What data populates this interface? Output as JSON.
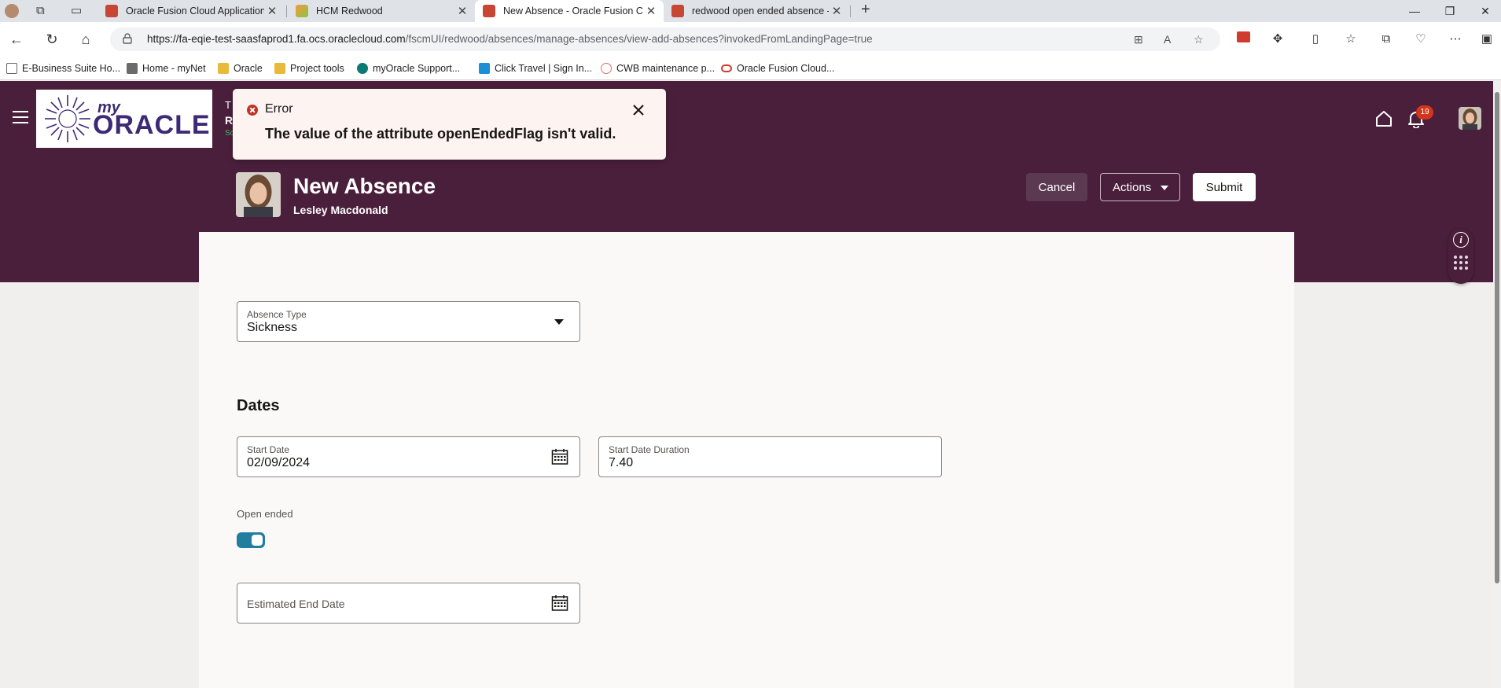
{
  "browser": {
    "tabs": [
      {
        "title": "Oracle Fusion Cloud Applications"
      },
      {
        "title": "HCM Redwood"
      },
      {
        "title": "New Absence - Oracle Fusion Clo"
      },
      {
        "title": "redwood open ended absence - C"
      }
    ],
    "address": {
      "host": "https://fa-eqie-test-saasfaprod1.fa.ocs.oraclecloud.com",
      "path": "/fscmUI/redwood/absences/manage-absences/view-add-absences?invokedFromLandingPage=true"
    },
    "bookmarks": [
      {
        "label": "E-Business Suite Ho...",
        "icon": "page-icon"
      },
      {
        "label": "Home - myNet",
        "icon": "mynet-icon"
      },
      {
        "label": "Oracle",
        "icon": "folder-icon"
      },
      {
        "label": "Project tools",
        "icon": "folder-icon"
      },
      {
        "label": "myOracle Support...",
        "icon": "sharepoint-icon"
      },
      {
        "label": "Click Travel | Sign In...",
        "icon": "travel-icon"
      },
      {
        "label": "CWB maintenance p...",
        "icon": "cwb-icon"
      },
      {
        "label": "Oracle Fusion Cloud...",
        "icon": "oracle-icon"
      }
    ]
  },
  "app": {
    "logo": {
      "my": "my",
      "oracle": "ORACLE"
    },
    "peek": {
      "line1": "T",
      "line2": "R",
      "line3": "Sc"
    },
    "notifications_count": "19",
    "error": {
      "title": "Error",
      "message": "The value of the attribute openEndedFlag isn't valid."
    },
    "header": {
      "title": "New Absence",
      "person": "Lesley Macdonald",
      "buttons": {
        "cancel": "Cancel",
        "actions": "Actions",
        "submit": "Submit"
      }
    },
    "form": {
      "absence_type": {
        "label": "Absence Type",
        "value": "Sickness"
      },
      "dates_heading": "Dates",
      "start_date": {
        "label": "Start Date",
        "value": "02/09/2024"
      },
      "start_duration": {
        "label": "Start Date Duration",
        "value": "7.40"
      },
      "open_ended": {
        "label": "Open ended",
        "on": true
      },
      "estimated_end_date": {
        "label": "Estimated End Date"
      }
    }
  },
  "colors": {
    "brand_band": "#4a1f3b",
    "switch_on": "#227e9e",
    "error_bg": "#fdf3f1",
    "error_icon": "#c03324",
    "badge": "#d2361a"
  }
}
